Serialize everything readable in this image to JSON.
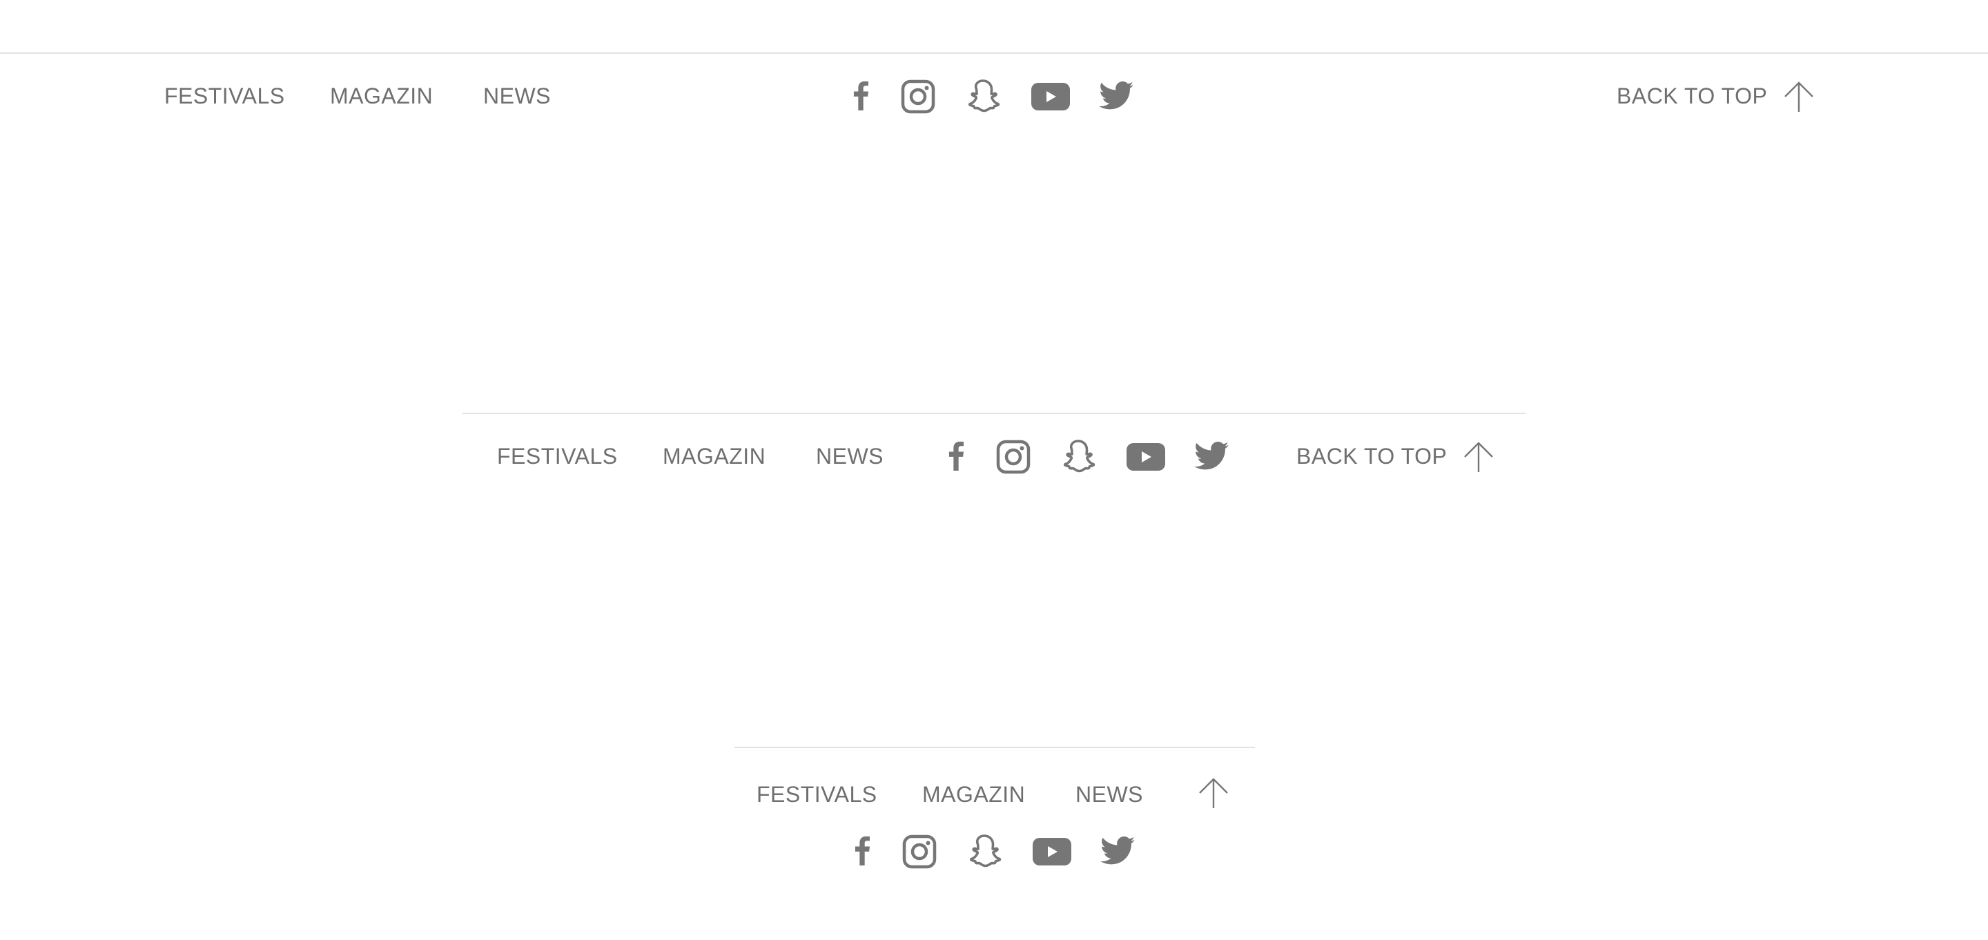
{
  "colors": {
    "text": "#6f6f6f",
    "icon": "#767676",
    "divider": "#e2e2e2",
    "background": "#ffffff"
  },
  "nav": {
    "festivals": "FESTIVALS",
    "magazin": "MAGAZIN",
    "news": "NEWS"
  },
  "back_to_top": "BACK TO TOP",
  "social_icons": [
    "facebook-icon",
    "instagram-icon",
    "snapchat-icon",
    "youtube-icon",
    "twitter-icon"
  ],
  "variants": [
    "desktop-wide",
    "tablet",
    "mobile"
  ]
}
